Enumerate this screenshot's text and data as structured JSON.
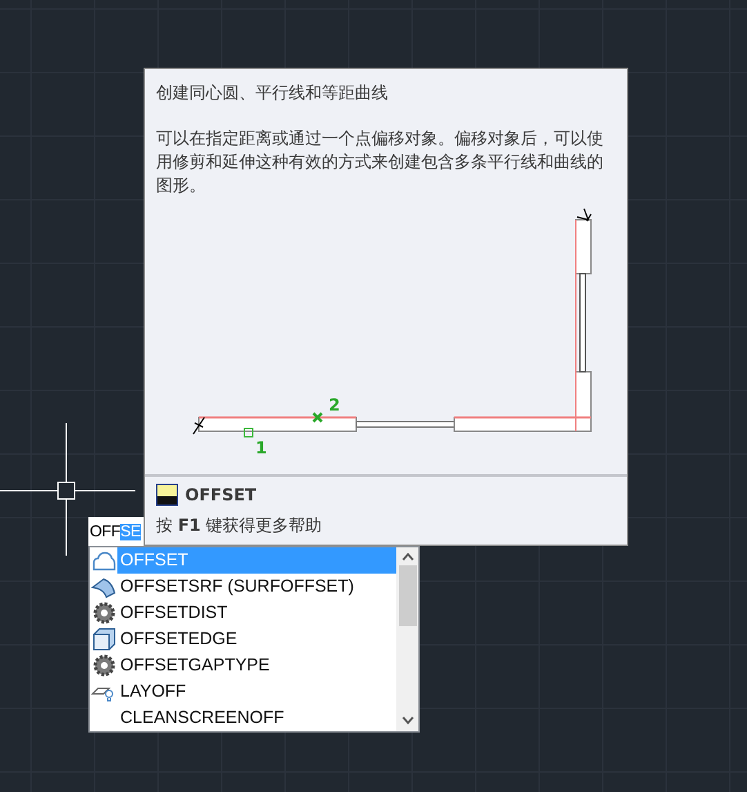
{
  "command_input": {
    "typed": "OFF",
    "selected": "SE"
  },
  "suggestions": [
    {
      "label": "OFFSET",
      "kind": "cloud",
      "selected": true
    },
    {
      "label": "OFFSETSRF (SURFOFFSET)",
      "kind": "surface",
      "selected": false
    },
    {
      "label": "OFFSETDIST",
      "kind": "gear",
      "selected": false
    },
    {
      "label": "OFFSETEDGE",
      "kind": "box",
      "selected": false
    },
    {
      "label": "OFFSETGAPTYPE",
      "kind": "gear",
      "selected": false
    },
    {
      "label": "LAYOFF",
      "kind": "layer",
      "selected": false
    },
    {
      "label": "CLEANSCREENOFF",
      "kind": "none",
      "selected": false
    }
  ],
  "tooltip": {
    "title": "创建同心圆、平行线和等距曲线",
    "description": "可以在指定距离或通过一个点偏移对象。偏移对象后，可以使用修剪和延伸这种有效的方式来创建包含多条平行线和曲线的图形。",
    "diagram_labels": [
      "1",
      "2"
    ],
    "command": "OFFSET",
    "help": "按 **F1** 键获得更多帮助"
  }
}
